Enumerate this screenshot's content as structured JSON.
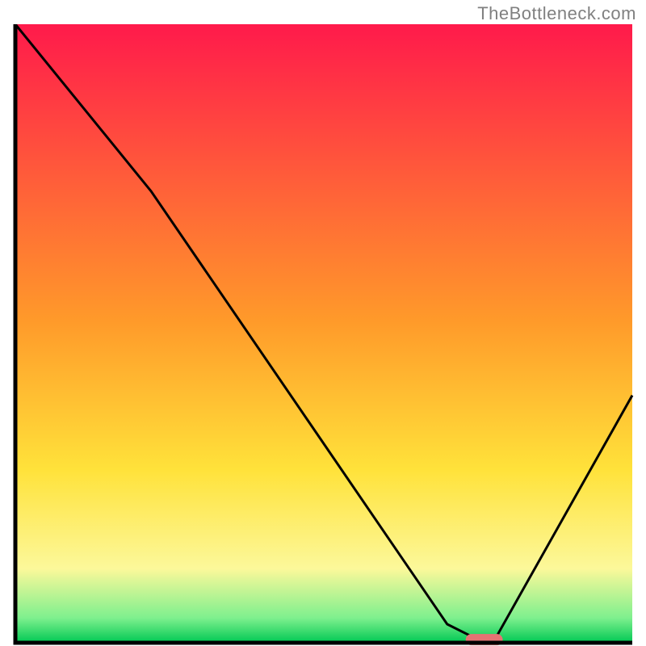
{
  "watermark": "TheBottleneck.com",
  "chart_data": {
    "type": "line",
    "title": "",
    "xlabel": "",
    "ylabel": "",
    "xlim": [
      0,
      100
    ],
    "ylim": [
      0,
      100
    ],
    "curve": [
      {
        "x": 0,
        "y": 100
      },
      {
        "x": 22,
        "y": 73
      },
      {
        "x": 70,
        "y": 3
      },
      {
        "x": 74,
        "y": 1
      },
      {
        "x": 78,
        "y": 1
      },
      {
        "x": 100,
        "y": 40
      }
    ],
    "optimum_marker": {
      "x_center": 76,
      "y": 0.5,
      "width": 6
    },
    "gradient_stops": [
      {
        "pct": 0,
        "color": "#ff1a4b"
      },
      {
        "pct": 48,
        "color": "#ff9a2a"
      },
      {
        "pct": 72,
        "color": "#ffe23a"
      },
      {
        "pct": 88,
        "color": "#fcf89a"
      },
      {
        "pct": 96,
        "color": "#7ef08e"
      },
      {
        "pct": 100,
        "color": "#00c853"
      }
    ],
    "axes_color": "#000000",
    "curve_color": "#000000",
    "marker_color": "#e57373"
  }
}
